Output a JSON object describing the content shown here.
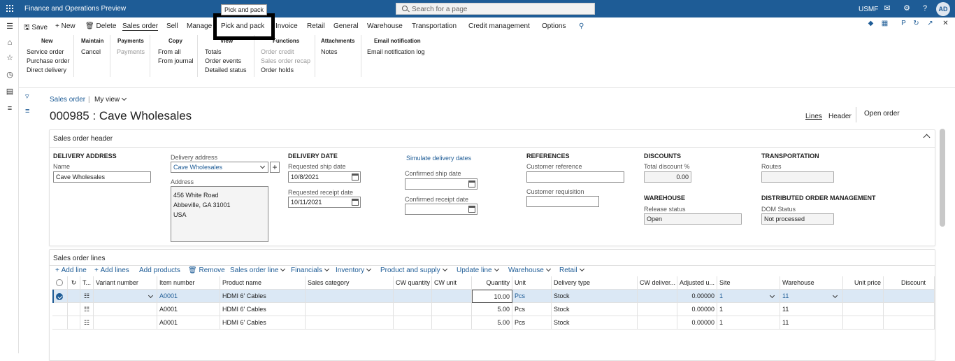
{
  "topbar": {
    "app_title": "Finance and Operations Preview",
    "search_placeholder": "Search for a page",
    "company": "USMF",
    "avatar_initials": "AD",
    "tooltip": "Pick and pack"
  },
  "actionbar": {
    "save": "Save",
    "new": "New",
    "delete": "Delete",
    "tabs": [
      "Sales order",
      "Sell",
      "Manage",
      "Pick and pack",
      "Invoice",
      "Retail",
      "General",
      "Warehouse",
      "Transportation",
      "Credit management",
      "Options"
    ]
  },
  "ribbon": {
    "new": {
      "header": "New",
      "items": [
        "Service order",
        "Purchase order",
        "Direct delivery"
      ]
    },
    "maintain": {
      "header": "Maintain",
      "items": [
        "Cancel"
      ]
    },
    "payments": {
      "header": "Payments",
      "items": [
        "Payments"
      ]
    },
    "copy": {
      "header": "Copy",
      "items": [
        "From all",
        "From journal"
      ]
    },
    "view": {
      "header": "View",
      "items": [
        "Totals",
        "Order events",
        "Detailed status"
      ]
    },
    "functions": {
      "header": "Functions",
      "items": [
        "Order credit",
        "Sales order recap",
        "Order holds"
      ]
    },
    "attachments": {
      "header": "Attachments",
      "items": [
        "Notes"
      ]
    },
    "email": {
      "header": "Email notification",
      "items": [
        "Email notification log"
      ]
    }
  },
  "breadcrumb": {
    "page": "Sales order",
    "view": "My view"
  },
  "page_title": "000985 : Cave Wholesales",
  "view_tabs": {
    "lines": "Lines",
    "header": "Header",
    "open_order": "Open order"
  },
  "header_panel": {
    "title": "Sales order header",
    "delivery_address": {
      "heading": "DELIVERY ADDRESS",
      "name_label": "Name",
      "name_value": "Cave Wholesales",
      "delivery_address_label": "Delivery address",
      "delivery_address_value": "Cave Wholesales",
      "address_label": "Address",
      "address_lines": [
        "456 White Road",
        "Abbeville, GA 31001",
        "USA"
      ]
    },
    "delivery_date": {
      "heading": "DELIVERY DATE",
      "requested_ship_label": "Requested ship date",
      "requested_ship_value": "10/8/2021",
      "requested_receipt_label": "Requested receipt date",
      "requested_receipt_value": "10/11/2021",
      "simulate_link": "Simulate delivery dates",
      "confirmed_ship_label": "Confirmed ship date",
      "confirmed_receipt_label": "Confirmed receipt date"
    },
    "references": {
      "heading": "REFERENCES",
      "customer_reference_label": "Customer reference",
      "customer_requisition_label": "Customer requisition"
    },
    "discounts": {
      "heading": "DISCOUNTS",
      "total_label": "Total discount %",
      "total_value": "0.00"
    },
    "warehouse": {
      "heading": "WAREHOUSE",
      "release_label": "Release status",
      "release_value": "Open"
    },
    "transportation": {
      "heading": "TRANSPORTATION",
      "routes_label": "Routes"
    },
    "dom": {
      "heading": "DISTRIBUTED ORDER MANAGEMENT",
      "status_label": "DOM Status",
      "status_value": "Not processed"
    }
  },
  "lines_panel": {
    "title": "Sales order lines",
    "toolbar": [
      "Add line",
      "Add lines",
      "Add products",
      "Remove",
      "Sales order line",
      "Financials",
      "Inventory",
      "Product and supply",
      "Update line",
      "Warehouse",
      "Retail"
    ],
    "columns": [
      "T...",
      "Variant number",
      "Item number",
      "Product name",
      "Sales category",
      "CW quantity",
      "CW unit",
      "Quantity",
      "Unit",
      "Delivery type",
      "CW deliver...",
      "Adjusted u...",
      "Site",
      "Warehouse",
      "Unit price",
      "Discount"
    ],
    "rows": [
      {
        "item": "A0001",
        "product": "HDMI 6' Cables",
        "quantity": "10.00",
        "unit": "Pcs",
        "delivery_type": "Stock",
        "adjusted": "0.00000",
        "site": "1",
        "warehouse": "11"
      },
      {
        "item": "A0001",
        "product": "HDMI 6' Cables",
        "quantity": "5.00",
        "unit": "Pcs",
        "delivery_type": "Stock",
        "adjusted": "0.00000",
        "site": "1",
        "warehouse": "11"
      },
      {
        "item": "A0001",
        "product": "HDMI 6' Cables",
        "quantity": "5.00",
        "unit": "Pcs",
        "delivery_type": "Stock",
        "adjusted": "0.00000",
        "site": "1",
        "warehouse": "11"
      }
    ]
  },
  "colors": {
    "brand": "#1e5c96",
    "selection": "#dbe8f5"
  }
}
